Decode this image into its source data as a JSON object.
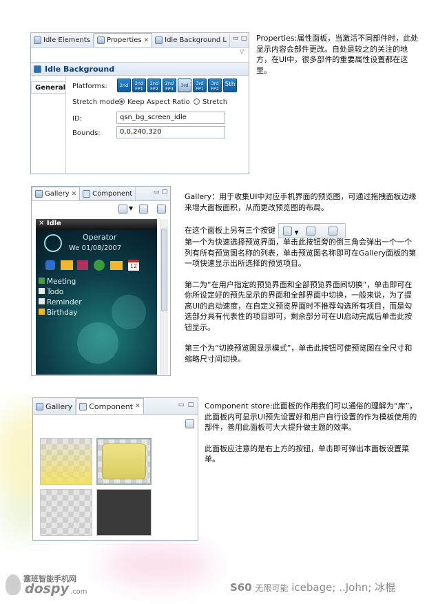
{
  "panel1": {
    "tabs": [
      "Idle Elements",
      "Properties",
      "Idle Background L"
    ],
    "title": "Idle Background",
    "side_tab": "General",
    "platforms_label": "Platforms:",
    "platforms": [
      "2nd",
      "2nd FP1",
      "2nd FP2",
      "2nd FP3",
      "3rd",
      "3rd FP1",
      "3rd FP2",
      "5th"
    ],
    "stretch_label": "Stretch mode:",
    "stretch_options": [
      "Keep Aspect Ratio",
      "Stretch"
    ],
    "id_label": "ID:",
    "id_value": "qsn_bg_screen_idle",
    "bounds_label": "Bounds:",
    "bounds_value": "0,0,240,320"
  },
  "desc1": {
    "title": "Properties:",
    "body": "属性面板，当激活不同部件时，此处显示内容会部件更改。自处是较之的关注的地方，在UI中，很多部件的重要属性设置都在这里。"
  },
  "panel2": {
    "tabs": [
      "Gallery",
      "Component"
    ],
    "idle_label": "Idle",
    "operator": "Operator",
    "date": "We 01/08/2007",
    "calendar_day": "12",
    "items": [
      "Meeting",
      "Todo",
      "Reminder",
      "Birthday"
    ]
  },
  "desc2": {
    "p1": "Gallery：用于收集UI中对应手机界面的预览图，可通过拖拽面板边缘来增大面板面积，从而更改预览图的布局。",
    "p2": "在这个面板上另有三个按键",
    "p3": "第一个为快速选择预览界面，单击此按钮旁的倒三角会弹出一个一个列有所有预览图名称的列表，单击预览图名称即可在Gallery面板的第一项快速显示出所选择的预览项目。",
    "p4": "第二为“在用户指定的预览界面和全部预览界面间切换”，单击即可在你所设定好的预先显示的界面和全部界面中切换，一般来说，为了提高UI的启动速度，在自定义预览界面时不推荐勾选所有项目，而是勾选部分具有代表性的项目即可，剩余部分可在UI启动完成后单击此按钮显示。",
    "p5": "第三个为“切换预览图显示模式”，单击此按钮可使预览图在全尺寸和缩略尺寸间切换。"
  },
  "panel3": {
    "tabs": [
      "Gallery",
      "Component"
    ]
  },
  "desc3": {
    "p1": "Component store:此面板的作用我们可以通俗的理解为“库”，此面板内可显示UI预先设置好和用户自行设置的作为模板使用的部件，善用此面板可大大提升做主题的效率。",
    "p2": "此面板应注意的是右上方的按钮，单击即可弹出本面板设置菜单。"
  },
  "footer": {
    "logo_cn": "塞班智能手机网",
    "logo_en": "dospy",
    "logo_suffix": ".com",
    "s60": "S60",
    "slogan": "无限可能",
    "credits": "icebage; ..John; 冰棍"
  },
  "colors": {
    "accent": "#0b5b9d",
    "panel_border": "#9fb0c6"
  }
}
